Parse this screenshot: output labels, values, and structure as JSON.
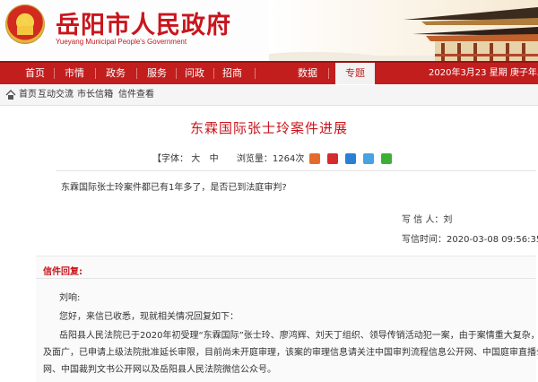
{
  "header": {
    "site_title": "岳阳市人民政府",
    "site_subtitle": "Yueyang Municipal People's Government"
  },
  "nav": {
    "items": [
      "首页",
      "市情",
      "政务",
      "服务",
      "问政",
      "招商",
      "数据",
      "专题"
    ],
    "active": "专题",
    "date_text": "2020年3月23  星期  庚子年二月"
  },
  "breadcrumb": {
    "items": [
      "首页",
      "互动交流",
      "市长信箱",
      "信件查看"
    ]
  },
  "article": {
    "title": "东霖国际张士玲案件进展",
    "font_label": "【字体：",
    "font_large": "大",
    "font_medium": "中",
    "views_text": "浏览量：1264次"
  },
  "letter": {
    "question": "东霖国际张士玲案件都已有1年多了，是否已到法庭审判?",
    "writer": "写 信 人：刘",
    "write_time": "写信时间：2020-03-08  09:56:35"
  },
  "reply": {
    "heading": "信件回复:",
    "salutation": "刘响:",
    "line1": "您好，来信已收悉，现就相关情况回复如下：",
    "line2": "岳阳县人民法院已于2020年初受理“东霖国际”张士玲、廖鸿辉、刘天丁组织、领导传销活动犯一案，由于案情重大复杂，涉",
    "line3": "及面广，已申请上级法院批准延长审限，目前尚未开庭审理，该案的审理信息请关注中国审判流程信息公开网、中国庭审直播公开",
    "line4": "网、中国裁判文书公开网以及岳阳县人民法院微信公众号。"
  },
  "colors": {
    "brand_red": "#c8161d",
    "nav_red": "#c21e1e"
  }
}
